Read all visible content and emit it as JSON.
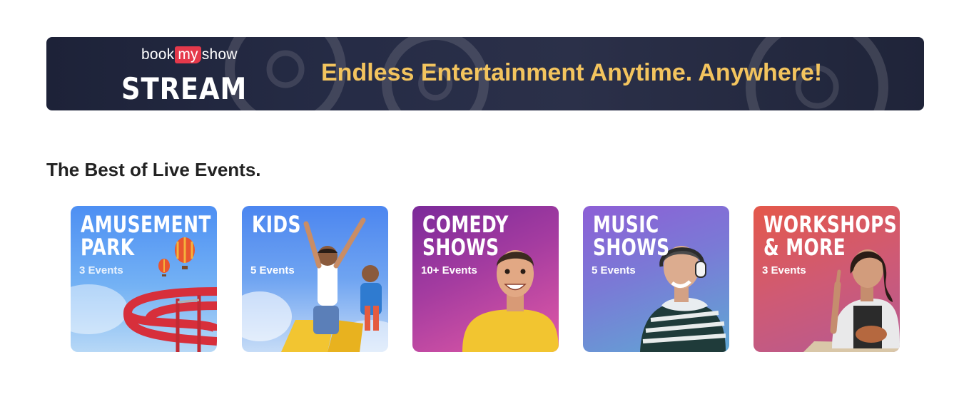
{
  "banner": {
    "brand_book": "book",
    "brand_my": "my",
    "brand_show": "show",
    "brand_stream": "STREAM",
    "tagline": "Endless Entertainment Anytime. Anywhere!",
    "tagline_color": "#f3c45e",
    "background_color": "#262c46"
  },
  "section": {
    "title": "The Best of Live Events."
  },
  "cards": [
    {
      "title_line1": "AMUSEMENT",
      "title_line2": "PARK",
      "count": "3 Events",
      "icon": "water-slide-balloons"
    },
    {
      "title_line1": "KIDS",
      "title_line2": "",
      "count": "5 Events",
      "icon": "kids-on-slide"
    },
    {
      "title_line1": "COMEDY",
      "title_line2": "SHOWS",
      "count": "10+ Events",
      "icon": "smiling-man"
    },
    {
      "title_line1": "MUSIC",
      "title_line2": "SHOWS",
      "count": "5 Events",
      "icon": "woman-headphones"
    },
    {
      "title_line1": "WORKSHOPS",
      "title_line2": "& MORE",
      "count": "3 Events",
      "icon": "woman-pottery"
    }
  ]
}
